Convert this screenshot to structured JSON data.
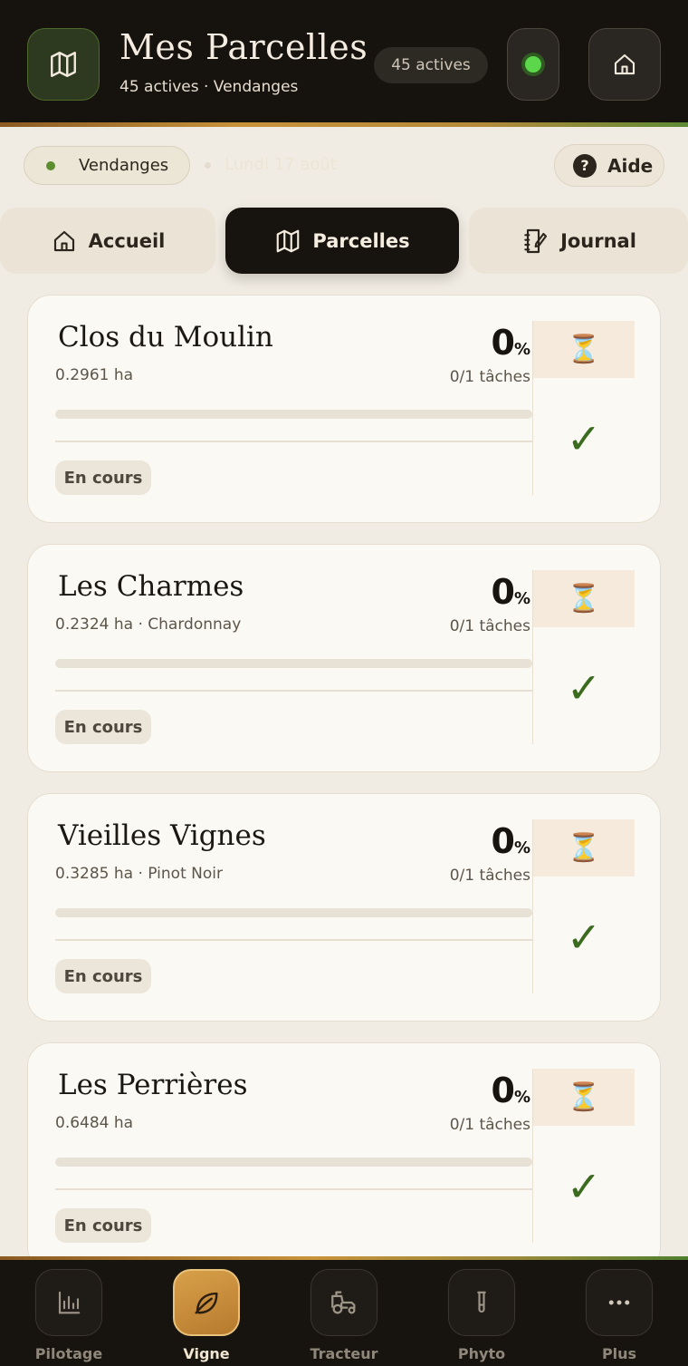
{
  "header": {
    "title": "Mes Parcelles",
    "subtitle": "45 actives · Vendanges",
    "count_pill": "45 actives",
    "map_icon": "map-icon",
    "status_icon": "status-dot-icon",
    "home_icon": "home-icon"
  },
  "subbar": {
    "season": "Vendanges",
    "date": "Lundi 17 août",
    "help_label": "Aide",
    "help_icon": "?"
  },
  "tabs": [
    {
      "label": "Accueil",
      "icon": "home-icon",
      "active": false
    },
    {
      "label": "Parcelles",
      "icon": "map-icon",
      "active": true
    },
    {
      "label": "Journal",
      "icon": "notebook-icon",
      "active": false
    }
  ],
  "parcels": [
    {
      "name": "Clos du Moulin",
      "meta": "0.2961 ha",
      "percent": "0",
      "percent_unit": "%",
      "tasks": "0/1 tâches",
      "progress": 0,
      "status": "En cours",
      "wait_icon": "⏳",
      "check_icon": "✓"
    },
    {
      "name": "Les Charmes",
      "meta": "0.2324 ha · Chardonnay",
      "percent": "0",
      "percent_unit": "%",
      "tasks": "0/1 tâches",
      "progress": 0,
      "status": "En cours",
      "wait_icon": "⏳",
      "check_icon": "✓"
    },
    {
      "name": "Vieilles Vignes",
      "meta": "0.3285 ha · Pinot Noir",
      "percent": "0",
      "percent_unit": "%",
      "tasks": "0/1 tâches",
      "progress": 0,
      "status": "En cours",
      "wait_icon": "⏳",
      "check_icon": "✓"
    },
    {
      "name": "Les Perrières",
      "meta": "0.6484 ha",
      "percent": "0",
      "percent_unit": "%",
      "tasks": "0/1 tâches",
      "progress": 0,
      "status": "En cours",
      "wait_icon": "⏳",
      "check_icon": "✓"
    }
  ],
  "bottom_nav": [
    {
      "label": "Pilotage",
      "icon": "bar-chart-icon",
      "active": false
    },
    {
      "label": "Vigne",
      "icon": "leaf-icon",
      "active": true
    },
    {
      "label": "Tracteur",
      "icon": "tractor-icon",
      "active": false
    },
    {
      "label": "Phyto",
      "icon": "test-tube-icon",
      "active": false
    },
    {
      "label": "Plus",
      "icon": "more-icon",
      "active": false
    }
  ],
  "colors": {
    "header_bg": "#16130f",
    "accent_green": "#3a6b1f",
    "accent_gold": "#c8923a",
    "page_bg": "#f1ece3",
    "status_dot": "#5cd64a"
  }
}
